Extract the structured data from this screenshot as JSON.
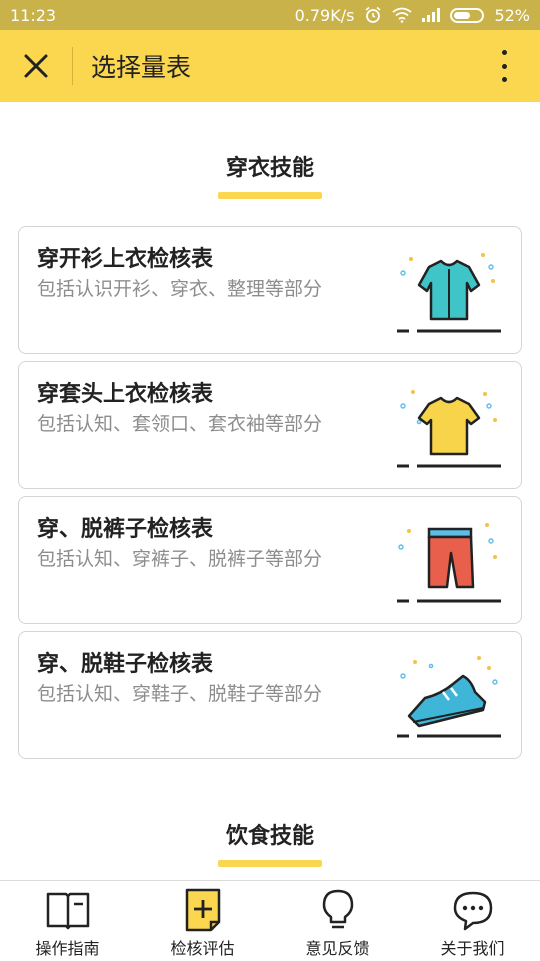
{
  "status": {
    "time": "11:23",
    "network_speed": "0.79K/s",
    "battery_percent": "52%"
  },
  "header": {
    "title": "选择量表"
  },
  "sections": [
    {
      "heading": "穿衣技能",
      "cards": [
        {
          "title": "穿开衫上衣检核表",
          "desc": "包括认识开衫、穿衣、整理等部分",
          "icon": "shirt-icon",
          "color": "#3fc4c8"
        },
        {
          "title": "穿套头上衣检核表",
          "desc": "包括认知、套领口、套衣袖等部分",
          "icon": "tshirt-icon",
          "color": "#f8d44a"
        },
        {
          "title": "穿、脱裤子检核表",
          "desc": "包括认知、穿裤子、脱裤子等部分",
          "icon": "pants-icon",
          "color": "#e8604c"
        },
        {
          "title": "穿、脱鞋子检核表",
          "desc": "包括认知、穿鞋子、脱鞋子等部分",
          "icon": "shoe-icon",
          "color": "#3fb6d8"
        }
      ]
    },
    {
      "heading": "饮食技能",
      "cards": []
    }
  ],
  "bottom_nav": [
    {
      "label": "操作指南",
      "icon": "book-icon"
    },
    {
      "label": "检核评估",
      "icon": "add-document-icon"
    },
    {
      "label": "意见反馈",
      "icon": "lightbulb-icon"
    },
    {
      "label": "关于我们",
      "icon": "chat-bubble-icon"
    }
  ],
  "colors": {
    "accent": "#fbd64f",
    "status_bar": "#c9b24a"
  }
}
